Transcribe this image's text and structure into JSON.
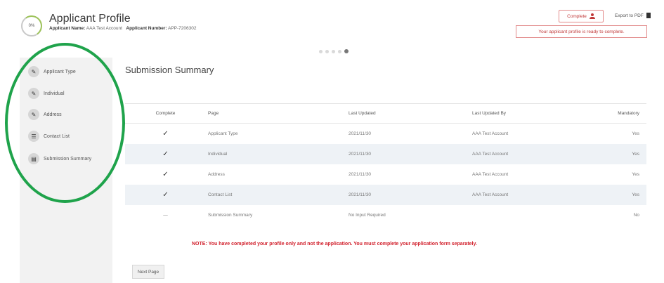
{
  "header": {
    "progress": "0%",
    "title": "Applicant Profile",
    "applicant_name_label": "Applicant Name:",
    "applicant_name": "AAA Test Account",
    "applicant_number_label": "Applicant Number:",
    "applicant_number": "APP-7206302",
    "complete_label": "Complete",
    "export_label": "Export to PDF",
    "ready_message": "Your applicant profile is ready to complete."
  },
  "sidebar": {
    "items": [
      {
        "label": "Applicant Type",
        "icon": "pencil-icon"
      },
      {
        "label": "Individual",
        "icon": "pencil-icon"
      },
      {
        "label": "Address",
        "icon": "pencil-icon"
      },
      {
        "label": "Contact List",
        "icon": "list-icon"
      },
      {
        "label": "Submission Summary",
        "icon": "summary-icon"
      }
    ]
  },
  "main": {
    "title": "Submission Summary",
    "columns": [
      "Complete",
      "Page",
      "Last Updated",
      "Last Updated By",
      "Mandatory"
    ],
    "rows": [
      {
        "complete": "✓",
        "page": "Applicant Type",
        "updated": "2021/11/30",
        "by": "AAA Test Account",
        "mandatory": "Yes"
      },
      {
        "complete": "✓",
        "page": "Individual",
        "updated": "2021/11/30",
        "by": "AAA Test Account",
        "mandatory": "Yes"
      },
      {
        "complete": "✓",
        "page": "Address",
        "updated": "2021/11/30",
        "by": "AAA Test Account",
        "mandatory": "Yes"
      },
      {
        "complete": "✓",
        "page": "Contact List",
        "updated": "2021/11/30",
        "by": "AAA Test Account",
        "mandatory": "Yes"
      },
      {
        "complete": "—",
        "page": "Submission Summary",
        "updated": "No Input Required",
        "by": "",
        "mandatory": "No"
      }
    ],
    "note": "NOTE: You have completed your profile only and not the application. You must complete your application form separately.",
    "next_label": "Next Page"
  },
  "colors": {
    "accent_red": "#c03939",
    "highlight_green": "#1fa34b",
    "shaded_row": "#eef2f6"
  }
}
